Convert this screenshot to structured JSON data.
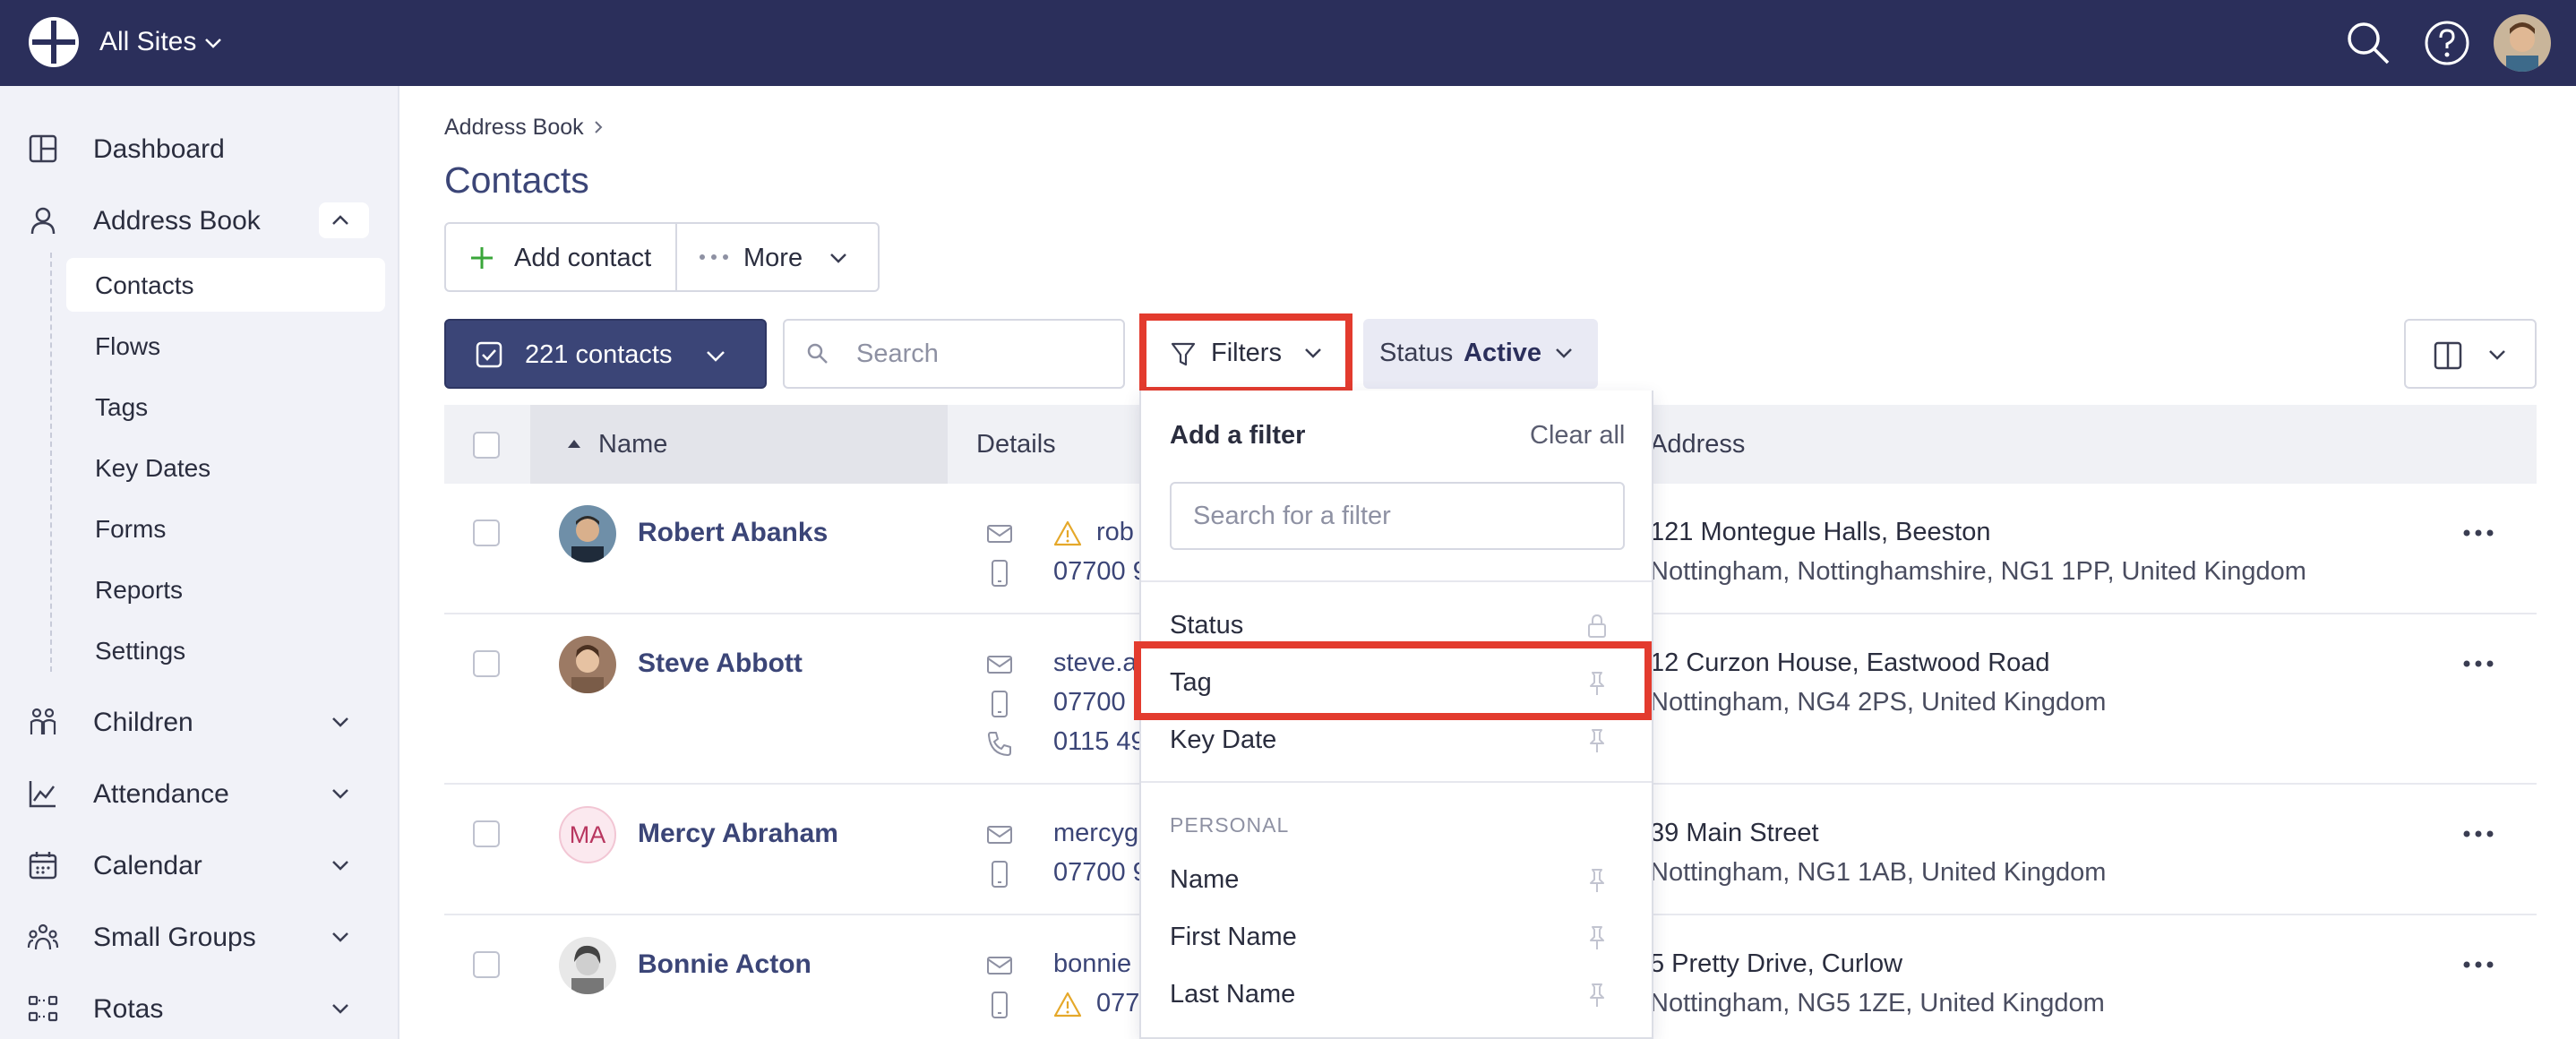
{
  "topbar": {
    "site_label": "All Sites",
    "icons": [
      "logo-icon",
      "search-icon",
      "help-icon",
      "avatar"
    ]
  },
  "sidebar": {
    "items": [
      {
        "label": "Dashboard",
        "icon": "dashboard-icon"
      },
      {
        "label": "Address Book",
        "icon": "person-icon",
        "expanded": true
      },
      {
        "label": "Children",
        "icon": "children-icon"
      },
      {
        "label": "Attendance",
        "icon": "chart-icon"
      },
      {
        "label": "Calendar",
        "icon": "calendar-icon"
      },
      {
        "label": "Small Groups",
        "icon": "group-icon"
      },
      {
        "label": "Rotas",
        "icon": "rota-icon"
      }
    ],
    "subitems": [
      "Contacts",
      "Flows",
      "Tags",
      "Key Dates",
      "Forms",
      "Reports",
      "Settings"
    ],
    "active_subitem": "Contacts"
  },
  "breadcrumb": "Address Book",
  "page_title": "Contacts",
  "toolbar": {
    "add_contact": "Add contact",
    "more": "More",
    "contacts_count": "221 contacts",
    "search_placeholder": "Search",
    "filters": "Filters",
    "status_key": "Status",
    "status_value": "Active"
  },
  "table": {
    "headers": {
      "name": "Name",
      "details": "Details",
      "address": "Address"
    },
    "rows": [
      {
        "name": "Robert Abanks",
        "d1": "rob",
        "d2": "07700 9",
        "addr1": "121 Montegue Halls, Beeston",
        "addr2": "Nottingham, Nottinghamshire, NG1 1PP, United Kingdom"
      },
      {
        "name": "Steve Abbott",
        "d1": "steve.a",
        "d2": "07700",
        "d3": "0115 49",
        "addr1": "12 Curzon House, Eastwood Road",
        "addr2": "Nottingham, NG4 2PS, United Kingdom"
      },
      {
        "name": "Mercy Abraham",
        "initials": "MA",
        "d1": "mercyg",
        "d2": "07700 9",
        "addr1": "39 Main Street",
        "addr2": "Nottingham, NG1 1AB, United Kingdom"
      },
      {
        "name": "Bonnie Acton",
        "d1": "bonnie",
        "d2": "077",
        "addr1": "5 Pretty Drive, Curlow",
        "addr2": "Nottingham, NG5 1ZE, United Kingdom"
      }
    ]
  },
  "filter_dropdown": {
    "title": "Add a filter",
    "clear_all": "Clear all",
    "search_placeholder": "Search for a filter",
    "pinned": [
      {
        "label": "Status",
        "icon": "lock-icon"
      },
      {
        "label": "Tag",
        "icon": "pin-icon"
      },
      {
        "label": "Key Date",
        "icon": "pin-icon"
      }
    ],
    "section_label": "PERSONAL",
    "personal": [
      {
        "label": "Name",
        "icon": "pin-icon"
      },
      {
        "label": "First Name",
        "icon": "pin-icon"
      },
      {
        "label": "Last Name",
        "icon": "pin-icon"
      }
    ]
  },
  "colors": {
    "topbar": "#2b2f5b",
    "accent": "#3b4577",
    "highlight": "#e33b2e",
    "warning": "#e5a82a"
  }
}
